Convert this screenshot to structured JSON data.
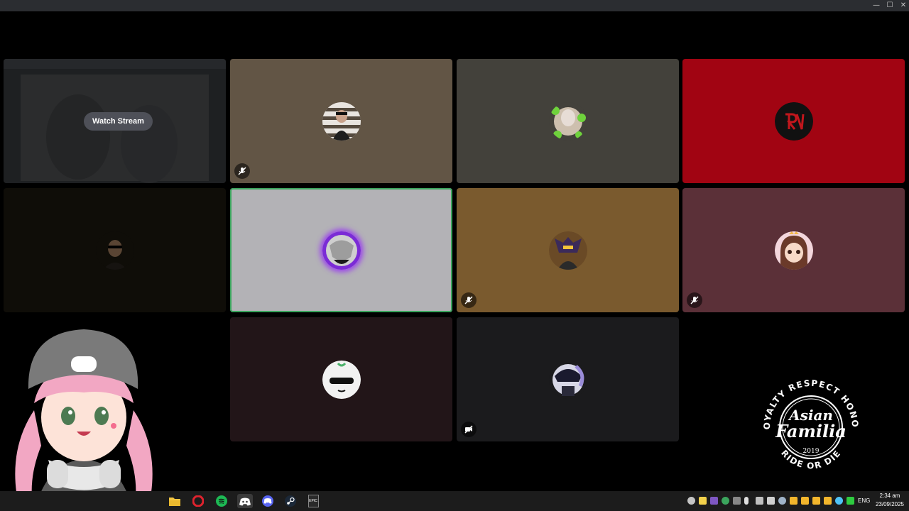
{
  "window": {
    "controls": [
      "minimize-icon",
      "maximize-icon",
      "close-icon"
    ],
    "titlebar_color": "#2b2d31"
  },
  "call": {
    "tiles": [
      {
        "name": "stream-tile",
        "bg": "#1f2123",
        "type": "stream",
        "watch_label": "Watch Stream"
      },
      {
        "name": "participant-tile-1",
        "bg": "#625545",
        "muted": true
      },
      {
        "name": "participant-tile-2",
        "bg": "#43413b",
        "muted": false
      },
      {
        "name": "participant-tile-3",
        "bg": "#a10412",
        "muted": false
      },
      {
        "name": "participant-tile-4",
        "bg": "#0f0d08",
        "muted": false
      },
      {
        "name": "participant-tile-5",
        "bg": "#b3b2b6",
        "speaking": true,
        "muted": false
      },
      {
        "name": "participant-tile-6",
        "bg": "#7a5a2e",
        "muted": true
      },
      {
        "name": "participant-tile-7",
        "bg": "#5b3038",
        "muted": true
      },
      {
        "name": "participant-tile-8",
        "bg": "#221518",
        "muted": false
      },
      {
        "name": "participant-tile-9",
        "bg": "#1b1b1d",
        "muted": true
      }
    ],
    "speaking_color": "#3ba55d"
  },
  "overlay": {
    "logo": {
      "ring_text": "LOYALTY RESPECT HONOR",
      "title_line1": "Asian",
      "title_line2": "Familia",
      "year": "2019",
      "bottom_text": "RIDE OR DIE"
    }
  },
  "taskbar": {
    "apps": [
      "file-explorer-icon",
      "opera-icon",
      "spotify-icon",
      "discord-icon",
      "discord-icon",
      "steam-icon",
      "epic-games-icon"
    ],
    "epic_label": "EPIC",
    "language": "ENG",
    "time": "2:34 am",
    "date": "23/09/2025"
  }
}
